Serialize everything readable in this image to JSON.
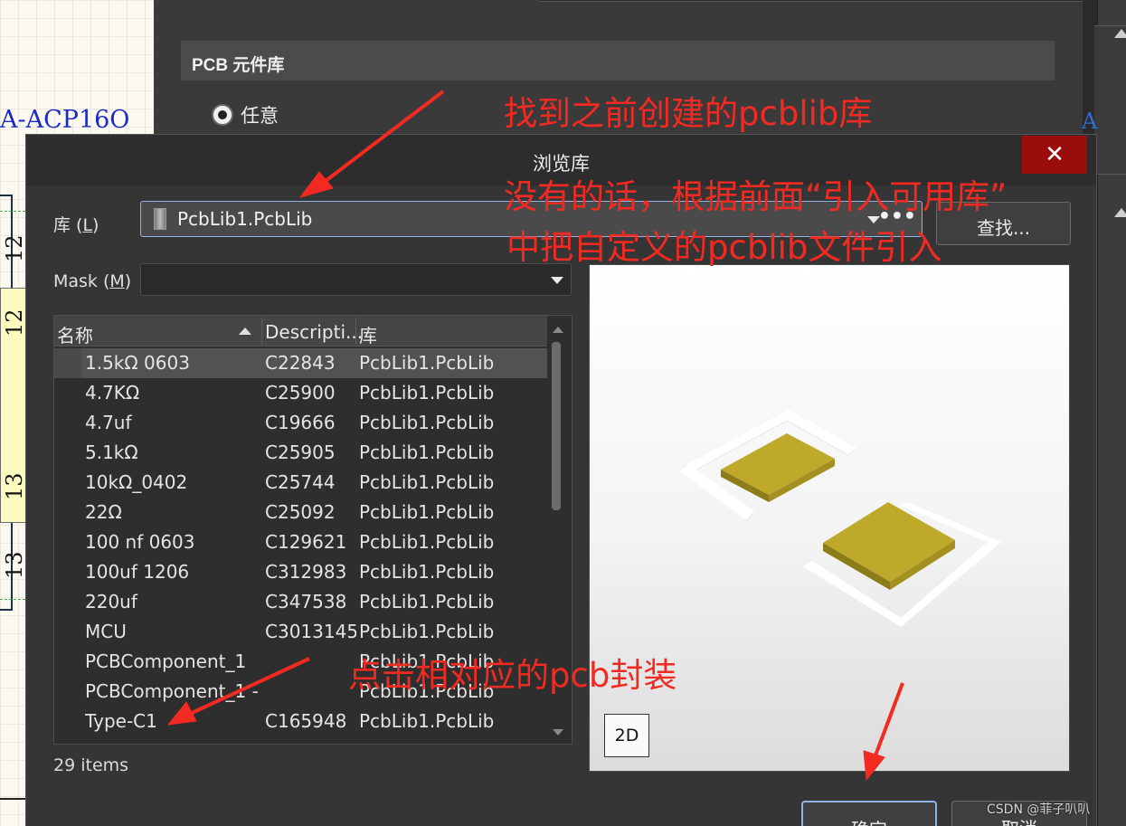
{
  "background": {
    "schematic": {
      "component_label": "A-ACP16O",
      "pin_numbers": [
        "12",
        "12",
        "13",
        "13"
      ],
      "right_edge_label": "A"
    },
    "properties_panel": {
      "section_title": "PCB 元件库",
      "radio_option": "任意"
    }
  },
  "dialog": {
    "title": "浏览库",
    "close_icon": "close-icon",
    "library_label_prefix": "库 (",
    "library_label_key": "L",
    "library_label_suffix": ")",
    "library_value": "PcbLib1.PcbLib",
    "find_button": "查找...",
    "mask_label_prefix": "Mask (",
    "mask_label_key": "M",
    "mask_label_suffix": ")",
    "mask_value": "",
    "table": {
      "columns": [
        "名称",
        "Descripti...",
        "库"
      ],
      "rows": [
        {
          "name": "1.5kΩ  0603",
          "description": "C22843",
          "library": "PcbLib1.PcbLib",
          "selected": true
        },
        {
          "name": "4.7KΩ",
          "description": "C25900",
          "library": "PcbLib1.PcbLib"
        },
        {
          "name": "4.7uf",
          "description": "C19666",
          "library": "PcbLib1.PcbLib"
        },
        {
          "name": "5.1kΩ",
          "description": "C25905",
          "library": "PcbLib1.PcbLib"
        },
        {
          "name": "10kΩ_0402",
          "description": "C25744",
          "library": "PcbLib1.PcbLib"
        },
        {
          "name": "22Ω",
          "description": "C25092",
          "library": "PcbLib1.PcbLib"
        },
        {
          "name": "100 nf  0603",
          "description": "C129621",
          "library": "PcbLib1.PcbLib"
        },
        {
          "name": "100uf    1206",
          "description": "C312983",
          "library": "PcbLib1.PcbLib"
        },
        {
          "name": "220uf",
          "description": "C347538",
          "library": "PcbLib1.PcbLib"
        },
        {
          "name": "MCU",
          "description": "C3013145",
          "library": "PcbLib1.PcbLib"
        },
        {
          "name": "PCBComponent_1",
          "description": "",
          "library": "PcbLib1.PcbLib"
        },
        {
          "name": "PCBComponent_1 -",
          "description": "",
          "library": "PcbLib1.PcbLib"
        },
        {
          "name": "Type-C1",
          "description": "C165948",
          "library": "PcbLib1.PcbLib"
        }
      ]
    },
    "item_count": "29 items",
    "preview": {
      "mode_button": "2D",
      "pad_color": "#bfa92a",
      "outline_color": "#ffffff"
    },
    "ok_button": "确定",
    "cancel_button": "取消"
  },
  "annotations": {
    "color": "#f22a22",
    "find_lib": "找到之前创建的pcblib库",
    "import_line1": "没有的话，根据前面“引入可用库”",
    "import_line2": "中把自定义的pcblib文件引入",
    "click_footprint": "点击相对应的pcb封装"
  },
  "watermark": "CSDN @菲子叭叭"
}
